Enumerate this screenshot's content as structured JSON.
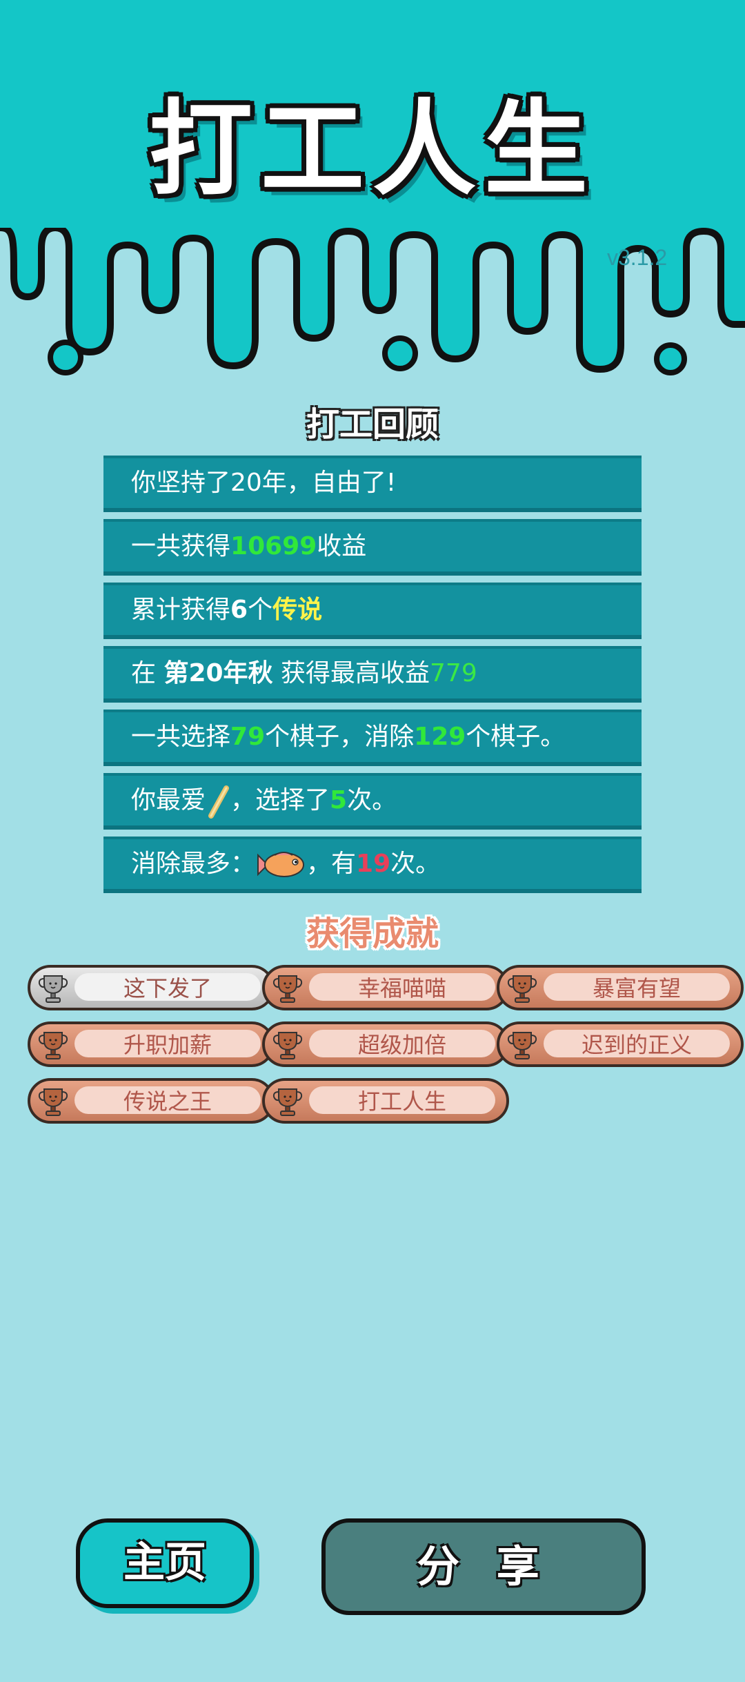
{
  "header": {
    "title": "打工人生",
    "version": "v3.1.2"
  },
  "review": {
    "title": "打工回顾",
    "rows": [
      {
        "t1": "你坚持了20年，自由了!"
      },
      {
        "t1": "一共获得",
        "v1": "10699",
        "t2": "收益"
      },
      {
        "t1": "累计获得",
        "v1": "6",
        "t2": "个",
        "v2": "传说"
      },
      {
        "t1": "在 ",
        "v1": "第20年秋",
        "t2": " 获得最高收益",
        "v2": "779"
      },
      {
        "t1": "一共选择",
        "v1": "79",
        "t2": "个棋子，消除",
        "v2": "129",
        "t3": "个棋子。"
      },
      {
        "t1": "你最爱",
        "icon": "pencil-icon",
        "t2": "，选择了",
        "v1": "5",
        "t3": "次。"
      },
      {
        "t1": "消除最多：",
        "icon": "fish-icon",
        "t2": "，有",
        "v1": "19",
        "t3": "次。"
      }
    ]
  },
  "achievements": {
    "title": "获得成就",
    "items": [
      {
        "label": "这下发了",
        "tier": "silver"
      },
      {
        "label": "幸福喵喵",
        "tier": "bronze"
      },
      {
        "label": "暴富有望",
        "tier": "bronze"
      },
      {
        "label": "升职加薪",
        "tier": "bronze"
      },
      {
        "label": "超级加倍",
        "tier": "bronze"
      },
      {
        "label": "迟到的正义",
        "tier": "bronze"
      },
      {
        "label": "传说之王",
        "tier": "bronze"
      },
      {
        "label": "打工人生",
        "tier": "bronze"
      }
    ]
  },
  "buttons": {
    "home": "主页",
    "share": "分 享"
  },
  "colors": {
    "header_bg": "#14c6c7",
    "page_bg": "#a2dfe6",
    "row_bg": "#13929f",
    "highlight_green": "#31e83a",
    "highlight_yellow": "#fff34a",
    "highlight_red": "#e8405a"
  }
}
